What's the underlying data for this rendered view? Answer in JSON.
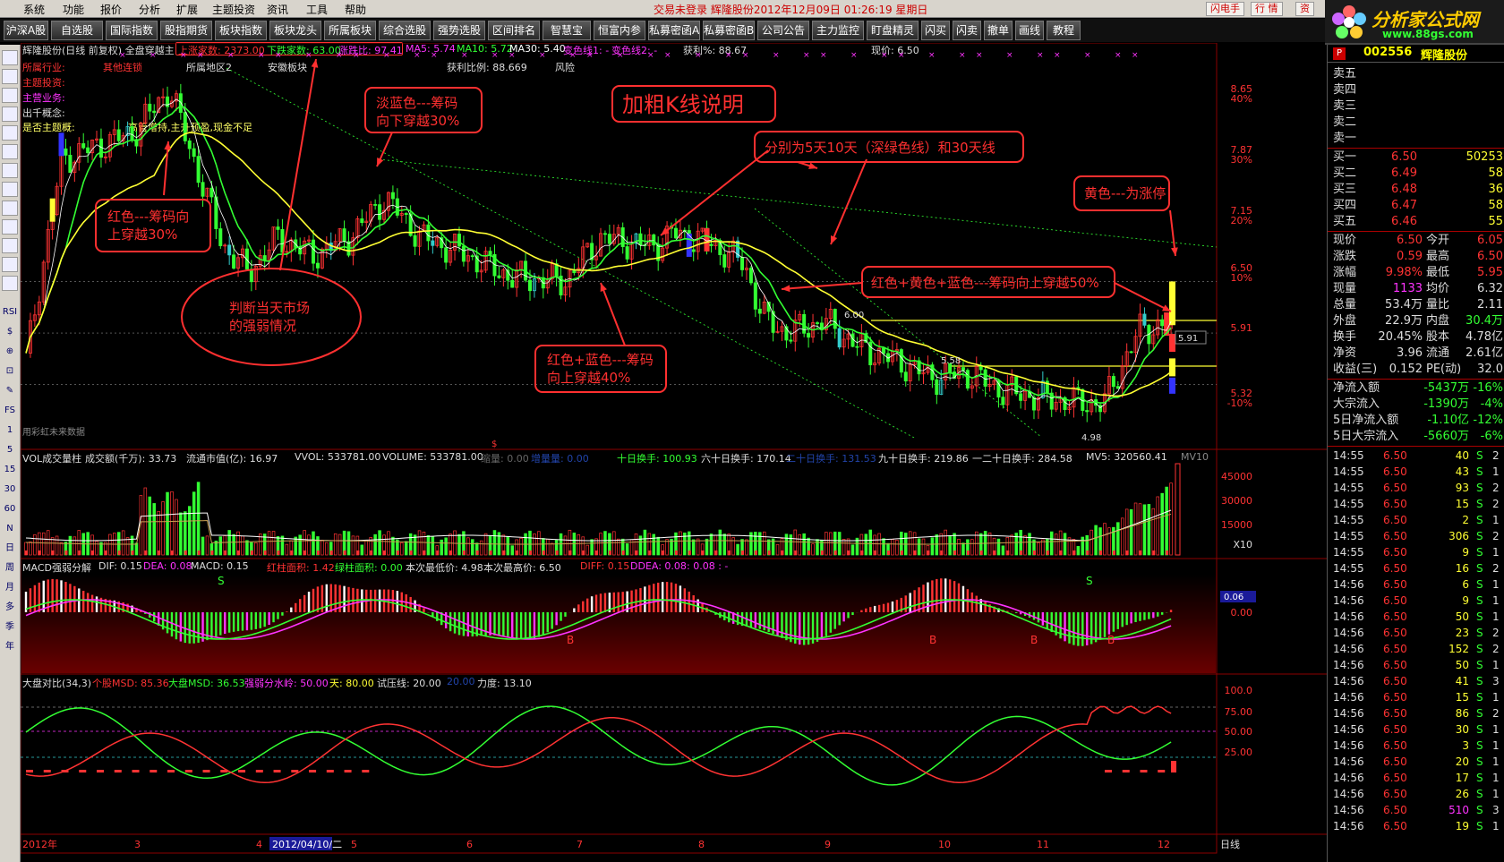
{
  "menubar": {
    "items": [
      "系统",
      "功能",
      "报价",
      "分析",
      "扩展",
      "主题投资",
      "资讯",
      "工具",
      "帮助"
    ],
    "title": "交易未登录   辉隆股份2012年12月09日  01:26:19 星期日",
    "btn_flash": "闪电手",
    "btn_quote": "行 情",
    "btn_info": "资"
  },
  "logo": {
    "text": "分析家公式网",
    "url": "www.88gs.com"
  },
  "tabs": [
    "沪深A股",
    "自选股",
    "国际指数",
    "股指期货",
    "板块指数",
    "板块龙头",
    "所属板块",
    "综合选股",
    "强势选股",
    "区间排名",
    "智慧宝",
    "恒富内参",
    "私募密函A",
    "私募密函B",
    "公司公告",
    "主力监控",
    "盯盘精灵",
    "闪买",
    "闪卖",
    "撤单",
    "画线",
    "教程"
  ],
  "left_tools": [
    "RSI",
    "$",
    "⊕",
    "⊡",
    "✎",
    "FS",
    "1",
    "5",
    "15",
    "30",
    "60",
    "N",
    "日",
    "周",
    "月",
    "多",
    "季",
    "年"
  ],
  "kline_header": {
    "name": "辉隆股份(日线 前复权) 全盘穿越主",
    "up_count": "上涨家数: 2373.00",
    "down_count": "下跌家数: 63.00",
    "ratio": "涨跌比: 97.41",
    "ma5": "MA5: 5.74",
    "ma10": "MA10: 5.72",
    "ma30": "MA30: 5.40",
    "line1": "变色线1: -",
    "line2": "变色线2: -",
    "profit": "获利%: 88.67",
    "price": "现价: 6.50",
    "profit_ratio": "获利比例: 88.669",
    "risk": "风险"
  },
  "info_lines": {
    "industry_label": "所属行业:",
    "industry_val": "其他连锁",
    "region_label": "所属地区2",
    "region_val": "安徽板块",
    "theme_label": "主题投资:",
    "business_label": "主营业务:",
    "concept_label": "出千概念:",
    "hot_label": "是否主题概:",
    "note": "高管增持,主升预盈,现金不足"
  },
  "price_axis": [
    {
      "v": "8.65",
      "p": "40%"
    },
    {
      "v": "7.87",
      "p": "30%"
    },
    {
      "v": "7.15",
      "p": "20%"
    },
    {
      "v": "6.50",
      "p": "10%"
    },
    {
      "v": "5.91",
      "p": ""
    },
    {
      "v": "5.32",
      "p": "-10%"
    }
  ],
  "price_marks": {
    "m1": "6.00",
    "m2": "5.58",
    "m3": "4.98",
    "last": "5.91"
  },
  "annotations": {
    "title": "加粗K线说明",
    "a1": [
      "淡蓝色---筹码",
      "向下穿越30%"
    ],
    "a2": [
      "红色---筹码向",
      "上穿越30%"
    ],
    "a3": "分别为5天10天（深绿色线）和30天线",
    "a4": "黄色---为涨停",
    "a5": "红色+黄色+蓝色---筹码向上穿越50%",
    "a6": [
      "红色+蓝色---筹码",
      "向上穿越40%"
    ],
    "a7": [
      "判断当天市场",
      "的强弱情况"
    ]
  },
  "watermark": "用彩虹未来数据",
  "vol_header": {
    "name": "VOL成交量柱",
    "amount": "成交额(千万): 33.73",
    "mcap": "流通市值(亿): 16.97",
    "vvol": "VVOL: 533781.00",
    "volume": "VOLUME: 533781.00",
    "shrink": "缩量: 0.00",
    "increase": "增量量: 0.00",
    "t10": "十日换手: 100.93",
    "t60": "六十日换手: 170.14",
    "t20": "二十日换手: 131.53",
    "t90": "九十日换手: 219.86",
    "t120": "一二十日换手: 284.58",
    "mv5": "MV5: 320560.41",
    "mv10": "MV10"
  },
  "vol_axis": [
    "45000",
    "30000",
    "15000",
    "X10"
  ],
  "macd_header": {
    "name": "MACD强弱分解",
    "dif": "DIF: 0.15",
    "dea": "DEA: 0.08",
    "macd": "MACD: 0.15",
    "red_area": "红柱面积: 1.42",
    "green_area": "绿柱面积: 0.00",
    "low": "本次最低价: 4.98",
    "high": "本次最高价: 6.50",
    "diff": "DIFF: 0.15",
    "ddea": "DDEA: 0.08",
    "extra": ": 0.08 : -"
  },
  "macd_axis": {
    "tag": "0.06",
    "zero": "0.00"
  },
  "macd_marks": {
    "s": "S",
    "b": "B"
  },
  "msd_header": {
    "name": "大盘对比(34,3)",
    "stock_msd": "个股MSD: 85.36",
    "market_msd": "大盘MSD: 36.53",
    "watershed": "强弱分水岭: 50.00",
    "sky": "天: 80.00",
    "test": "试压线: 20.00",
    "x20": "20.00",
    "force": "力度: 13.10"
  },
  "msd_axis": [
    "100.0",
    "75.00",
    "50.00",
    "25.00"
  ],
  "date_axis": {
    "year": "2012年",
    "m3": "3",
    "m4": "4",
    "cursor": "2012/04/10/二",
    "m5": "5",
    "m6": "6",
    "m7": "7",
    "m8": "8",
    "m9": "9",
    "m10": "10",
    "m11": "11",
    "m12": "12",
    "period": "日线"
  },
  "right_panel": {
    "icon": "P",
    "code": "002556",
    "name": "辉隆股份",
    "asks": [
      "卖五",
      "卖四",
      "卖三",
      "卖二",
      "卖一"
    ],
    "bids": [
      {
        "label": "买一",
        "price": "6.50",
        "vol": "50253"
      },
      {
        "label": "买二",
        "price": "6.49",
        "vol": "58"
      },
      {
        "label": "买三",
        "price": "6.48",
        "vol": "36"
      },
      {
        "label": "买四",
        "price": "6.47",
        "vol": "58"
      },
      {
        "label": "买五",
        "price": "6.46",
        "vol": "55"
      }
    ],
    "stats": [
      {
        "l1": "现价",
        "v1": "6.50",
        "l2": "今开",
        "v2": "6.05"
      },
      {
        "l1": "涨跌",
        "v1": "0.59",
        "l2": "最高",
        "v2": "6.50"
      },
      {
        "l1": "涨幅",
        "v1": "9.98%",
        "l2": "最低",
        "v2": "5.95"
      },
      {
        "l1": "现量",
        "v1": "1133",
        "l2": "均价",
        "v2": "6.32"
      },
      {
        "l1": "总量",
        "v1": "53.4万",
        "l2": "量比",
        "v2": "2.11"
      },
      {
        "l1": "外盘",
        "v1": "22.9万",
        "l2": "内盘",
        "v2": "30.4万"
      },
      {
        "l1": "换手",
        "v1": "20.45%",
        "l2": "股本",
        "v2": "4.78亿"
      },
      {
        "l1": "净资",
        "v1": "3.96",
        "l2": "流通",
        "v2": "2.61亿"
      },
      {
        "l1": "收益(三)",
        "v1": "0.152",
        "l2": "PE(动)",
        "v2": "32.0"
      }
    ],
    "flows": [
      {
        "l": "净流入额",
        "v": "-5437万",
        "p": "-16%"
      },
      {
        "l": "大宗流入",
        "v": "-1390万",
        "p": "-4%"
      },
      {
        "l": "5日净流入额",
        "v": "-1.10亿",
        "p": "-12%"
      },
      {
        "l": "5日大宗流入",
        "v": "-5660万",
        "p": "-6%"
      }
    ],
    "ticks": [
      {
        "t": "14:55",
        "p": "6.50",
        "v": "40",
        "d": "S",
        "n": "2"
      },
      {
        "t": "14:55",
        "p": "6.50",
        "v": "43",
        "d": "S",
        "n": "1"
      },
      {
        "t": "14:55",
        "p": "6.50",
        "v": "93",
        "d": "S",
        "n": "2"
      },
      {
        "t": "14:55",
        "p": "6.50",
        "v": "15",
        "d": "S",
        "n": "2"
      },
      {
        "t": "14:55",
        "p": "6.50",
        "v": "2",
        "d": "S",
        "n": "1"
      },
      {
        "t": "14:55",
        "p": "6.50",
        "v": "306",
        "d": "S",
        "n": "2"
      },
      {
        "t": "14:55",
        "p": "6.50",
        "v": "9",
        "d": "S",
        "n": "1"
      },
      {
        "t": "14:55",
        "p": "6.50",
        "v": "16",
        "d": "S",
        "n": "2"
      },
      {
        "t": "14:56",
        "p": "6.50",
        "v": "6",
        "d": "S",
        "n": "1"
      },
      {
        "t": "14:56",
        "p": "6.50",
        "v": "9",
        "d": "S",
        "n": "1"
      },
      {
        "t": "14:56",
        "p": "6.50",
        "v": "50",
        "d": "S",
        "n": "1"
      },
      {
        "t": "14:56",
        "p": "6.50",
        "v": "23",
        "d": "S",
        "n": "2"
      },
      {
        "t": "14:56",
        "p": "6.50",
        "v": "152",
        "d": "S",
        "n": "2"
      },
      {
        "t": "14:56",
        "p": "6.50",
        "v": "50",
        "d": "S",
        "n": "1"
      },
      {
        "t": "14:56",
        "p": "6.50",
        "v": "41",
        "d": "S",
        "n": "3"
      },
      {
        "t": "14:56",
        "p": "6.50",
        "v": "15",
        "d": "S",
        "n": "1"
      },
      {
        "t": "14:56",
        "p": "6.50",
        "v": "86",
        "d": "S",
        "n": "2"
      },
      {
        "t": "14:56",
        "p": "6.50",
        "v": "30",
        "d": "S",
        "n": "1"
      },
      {
        "t": "14:56",
        "p": "6.50",
        "v": "3",
        "d": "S",
        "n": "1"
      },
      {
        "t": "14:56",
        "p": "6.50",
        "v": "20",
        "d": "S",
        "n": "1"
      },
      {
        "t": "14:56",
        "p": "6.50",
        "v": "17",
        "d": "S",
        "n": "1"
      },
      {
        "t": "14:56",
        "p": "6.50",
        "v": "26",
        "d": "S",
        "n": "1"
      },
      {
        "t": "14:56",
        "p": "6.50",
        "v": "510",
        "d": "S",
        "n": "3"
      },
      {
        "t": "14:56",
        "p": "6.50",
        "v": "19",
        "d": "S",
        "n": "1"
      }
    ]
  },
  "colors": {
    "up": "#ff3333",
    "down": "#33ff33",
    "ma5": "#ffffff",
    "ma10": "#33ff33",
    "ma30": "#ffff33",
    "annotation": "#ff3030",
    "panel_border": "#8b0000"
  }
}
